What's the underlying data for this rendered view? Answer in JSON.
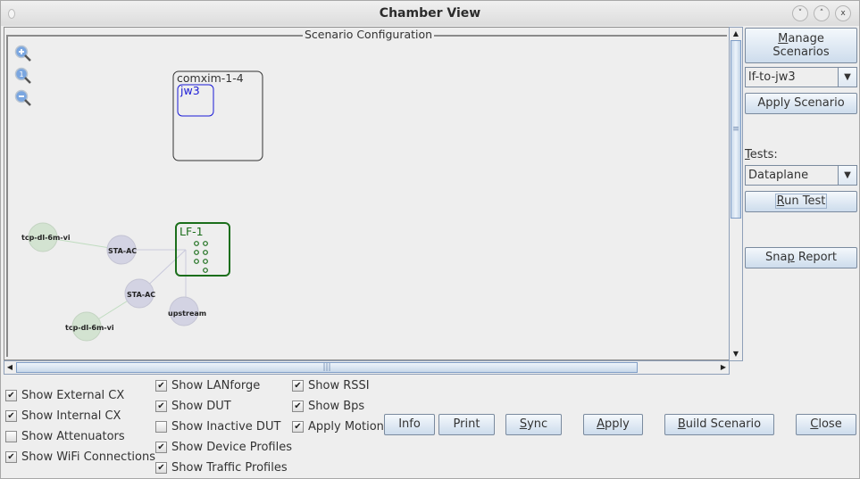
{
  "window": {
    "title": "Chamber View",
    "controls": {
      "minimize": "˅",
      "maximize": "˄",
      "close": "x"
    }
  },
  "canvas": {
    "title": "Scenario Configuration",
    "zoom_icons": [
      "zoom-in-icon",
      "zoom-reset-icon",
      "zoom-out-icon"
    ],
    "chamber": {
      "label": "comxim-1-4",
      "dut": "jw3"
    },
    "lanforge": {
      "label": "LF-1",
      "ports": 7
    },
    "nodes": [
      {
        "label": "tcp-dl-6m-vi",
        "kind": "traffic-profile"
      },
      {
        "label": "STA-AC",
        "kind": "device-profile"
      },
      {
        "label": "STA-AC",
        "kind": "device-profile"
      },
      {
        "label": "tcp-dl-6m-vi",
        "kind": "traffic-profile"
      },
      {
        "label": "upstream",
        "kind": "device-profile"
      }
    ]
  },
  "sidebar": {
    "manage_line1": "Manage",
    "manage_line1_rest": "anage",
    "manage_line2": "Scenarios",
    "scenario_selected": "lf-to-jw3",
    "apply_scenario": "Apply Scenario",
    "tests_label": "Tests:",
    "tests_label_rest": "ests:",
    "tests_selected": "Dataplane",
    "run_test": "Run Test",
    "run_test_rest": "un Test",
    "snap_report_a": "Sna",
    "snap_report_b": "p",
    "snap_report_c": " Report"
  },
  "options": {
    "col1": [
      {
        "label": "Show External CX",
        "checked": true
      },
      {
        "label": "Show Internal CX",
        "checked": true
      },
      {
        "label": "Show Attenuators",
        "checked": false
      },
      {
        "label": "Show WiFi Connections",
        "checked": true
      }
    ],
    "col2": [
      {
        "label": "Show LANforge",
        "checked": true
      },
      {
        "label": "Show DUT",
        "checked": true
      },
      {
        "label": "Show Inactive DUT",
        "checked": false
      },
      {
        "label": "Show Device Profiles",
        "checked": true
      },
      {
        "label": "Show Traffic Profiles",
        "checked": true
      }
    ],
    "col3": [
      {
        "label": "Show RSSI",
        "checked": true
      },
      {
        "label": "Show Bps",
        "checked": true
      },
      {
        "label": "Apply Motion",
        "checked": true
      }
    ]
  },
  "buttons": {
    "info": "Info",
    "print": "Print",
    "sync_u": "S",
    "sync_rest": "ync",
    "apply_u": "A",
    "apply_rest": "pply",
    "build_u": "B",
    "build_rest": "uild Scenario",
    "close_u": "C",
    "close_rest": "lose"
  },
  "check_glyph": "✔"
}
